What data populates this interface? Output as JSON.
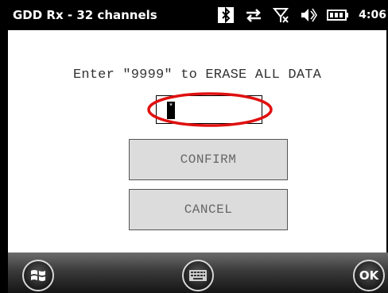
{
  "titlebar": {
    "title": "GDD Rx - 32 channels",
    "time": "4:06",
    "icons": [
      "bluetooth-icon",
      "sync-arrows-icon",
      "signal-off-icon",
      "volume-icon",
      "battery-icon"
    ]
  },
  "dialog": {
    "prompt": "Enter \"9999\" to ERASE ALL DATA",
    "input_value": "*",
    "confirm_label": "CONFIRM",
    "cancel_label": "CANCEL",
    "highlight_color": "#e01010"
  },
  "softkeys": {
    "start": "windows-start-icon",
    "keyboard": "keyboard-icon",
    "ok_label": "OK"
  }
}
